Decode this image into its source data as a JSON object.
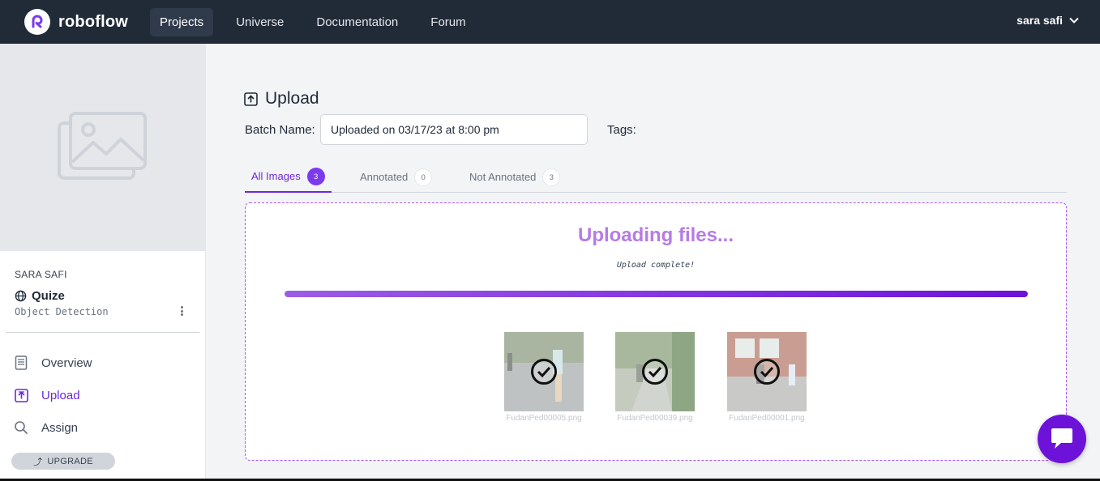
{
  "brand": {
    "name": "roboflow"
  },
  "nav": {
    "items": [
      {
        "label": "Projects",
        "active": true
      },
      {
        "label": "Universe",
        "active": false
      },
      {
        "label": "Documentation",
        "active": false
      },
      {
        "label": "Forum",
        "active": false
      }
    ],
    "user": "sara safi"
  },
  "sidebar": {
    "owner": "SARA SAFI",
    "project_name": "Quize",
    "project_type": "Object Detection",
    "items": [
      {
        "label": "Overview",
        "icon": "book-icon"
      },
      {
        "label": "Upload",
        "icon": "upload-icon",
        "active": true
      },
      {
        "label": "Assign",
        "icon": "search-icon"
      }
    ],
    "upgrade_label": "UPGRADE",
    "upgrade_icon": "⤴"
  },
  "upload": {
    "title": "Upload",
    "batch_label": "Batch Name:",
    "batch_value": "Uploaded on 03/17/23 at 8:00 pm",
    "tags_label": "Tags:",
    "tabs": [
      {
        "label": "All Images",
        "count": "3",
        "active": true
      },
      {
        "label": "Annotated",
        "count": "0"
      },
      {
        "label": "Not Annotated",
        "count": "3"
      }
    ],
    "status_title": "Uploading files...",
    "status_sub": "Upload complete!",
    "progress": 1.0,
    "files": [
      {
        "name": "FudanPed00005.png"
      },
      {
        "name": "FudanPed00039.png"
      },
      {
        "name": "FudanPed00001.png"
      }
    ]
  },
  "colors": {
    "accent": "#6d28d9",
    "topbar": "#212a37",
    "status_title": "#b57be6"
  }
}
